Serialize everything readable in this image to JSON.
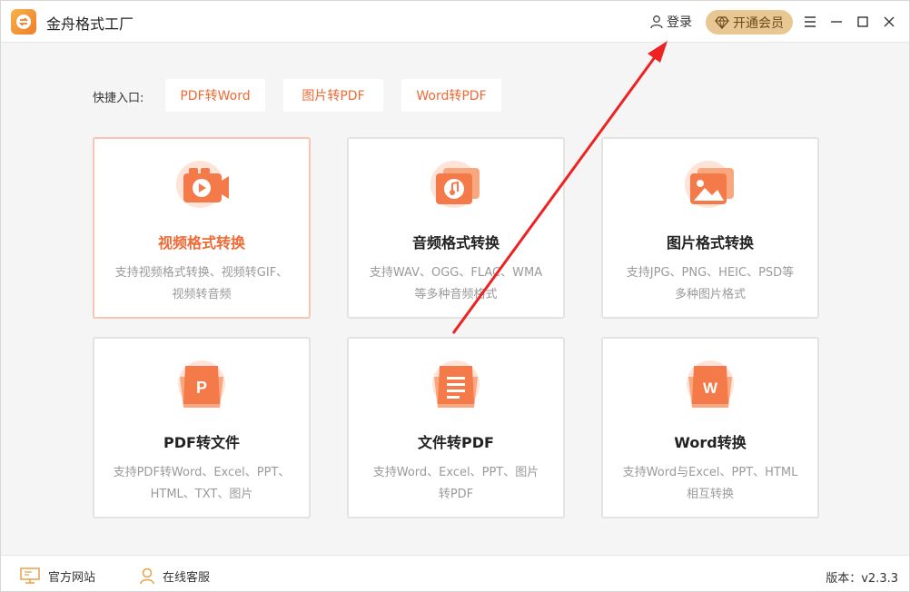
{
  "app": {
    "title": "金舟格式工厂"
  },
  "header": {
    "login_label": "登录",
    "vip_label": "开通会员"
  },
  "quick": {
    "label": "快捷入口:",
    "buttons": [
      "PDF转Word",
      "图片转PDF",
      "Word转PDF"
    ]
  },
  "cards": [
    {
      "title": "视频格式转换",
      "desc1": "支持视频格式转换、视频转GIF、",
      "desc2": "视频转音频",
      "icon": "video-icon"
    },
    {
      "title": "音频格式转换",
      "desc1": "支持WAV、OGG、FLAC、WMA",
      "desc2": "等多种音频格式",
      "icon": "music-icon"
    },
    {
      "title": "图片格式转换",
      "desc1": "支持JPG、PNG、HEIC、PSD等",
      "desc2": "多种图片格式",
      "icon": "image-icon"
    },
    {
      "title": "PDF转文件",
      "desc1": "支持PDF转Word、Excel、PPT、",
      "desc2": "HTML、TXT、图片",
      "icon": "ppt-file-icon"
    },
    {
      "title": "文件转PDF",
      "desc1": "支持Word、Excel、PPT、图片",
      "desc2": "转PDF",
      "icon": "document-lines-icon"
    },
    {
      "title": "Word转换",
      "desc1": "支持Word与Excel、PPT、HTML",
      "desc2": "相互转换",
      "icon": "word-file-icon"
    }
  ],
  "footer": {
    "website_label": "官方网站",
    "support_label": "在线客服",
    "version_label": "版本：v2.3.3"
  },
  "colors": {
    "accent": "#f06a35",
    "vip_bg": "#e9c792",
    "annotation_arrow": "#ee2222"
  }
}
